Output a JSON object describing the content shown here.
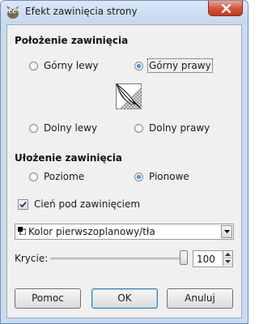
{
  "window": {
    "title": "Efekt zawinięcia strony",
    "icon": "gimp-wilber-icon",
    "close_icon": "close-icon"
  },
  "curl_location": {
    "title": "Położenie zawinięcia",
    "options": [
      {
        "label": "Górny lewy",
        "selected": false
      },
      {
        "label": "Górny prawy",
        "selected": true
      },
      {
        "label": "Dolny lewy",
        "selected": false
      },
      {
        "label": "Dolny prawy",
        "selected": false
      }
    ],
    "preview_icon": "page-curl-preview-icon"
  },
  "curl_orientation": {
    "title": "Ułożenie zawinięcia",
    "options": [
      {
        "label": "Poziome",
        "selected": false
      },
      {
        "label": "Pionowe",
        "selected": true
      }
    ]
  },
  "shadow": {
    "label": "Cień pod zawinięciem",
    "checked": true
  },
  "gradient_combo": {
    "selected": "Kolor pierwszoplanowy/tła"
  },
  "opacity": {
    "label": "Krycie:",
    "value": "100",
    "level": 100
  },
  "buttons": {
    "help": "Pomoc",
    "ok": "OK",
    "cancel": "Anuluj"
  },
  "colors": {
    "frame": "#c9dbef",
    "close_button": "#d6553e",
    "client_bg": "#f0f0f0",
    "radio_selected": "#1c5fb8"
  }
}
